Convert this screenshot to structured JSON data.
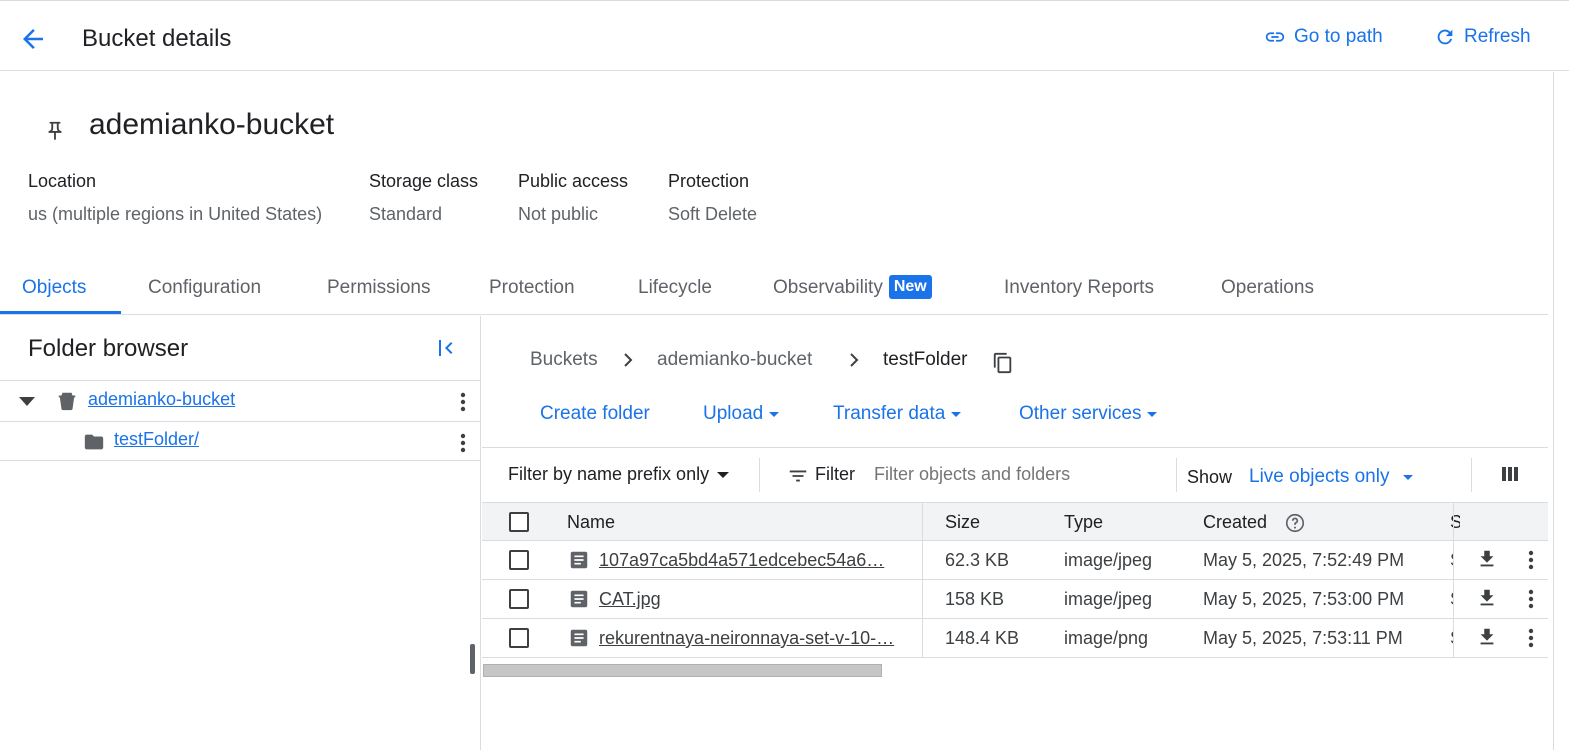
{
  "header": {
    "title": "Bucket details",
    "goto_path": "Go to path",
    "refresh": "Refresh"
  },
  "bucket": {
    "name": "ademianko-bucket",
    "info": [
      {
        "label": "Location",
        "value": "us (multiple regions in United States)"
      },
      {
        "label": "Storage class",
        "value": "Standard"
      },
      {
        "label": "Public access",
        "value": "Not public"
      },
      {
        "label": "Protection",
        "value": "Soft Delete"
      }
    ]
  },
  "tabs": [
    {
      "label": "Objects",
      "active": true
    },
    {
      "label": "Configuration"
    },
    {
      "label": "Permissions"
    },
    {
      "label": "Protection"
    },
    {
      "label": "Lifecycle"
    },
    {
      "label": "Observability",
      "badge": "New"
    },
    {
      "label": "Inventory Reports"
    },
    {
      "label": "Operations"
    }
  ],
  "folder_browser": {
    "title": "Folder browser",
    "items": [
      {
        "label": "ademianko-bucket",
        "type": "bucket"
      },
      {
        "label": "testFolder/",
        "type": "folder"
      }
    ]
  },
  "breadcrumb": {
    "items": [
      "Buckets",
      "ademianko-bucket",
      "testFolder"
    ]
  },
  "actions": {
    "create_folder": "Create folder",
    "upload": "Upload",
    "transfer_data": "Transfer data",
    "other_services": "Other services"
  },
  "filter": {
    "mode": "Filter by name prefix only",
    "label": "Filter",
    "placeholder": "Filter objects and folders",
    "show_label": "Show",
    "show_value": "Live objects only"
  },
  "table": {
    "columns": [
      "Name",
      "Size",
      "Type",
      "Created",
      "S"
    ],
    "rows": [
      {
        "name": "107a97ca5bd4a571edcebec54a6…",
        "size": "62.3 KB",
        "type": "image/jpeg",
        "created": "May 5, 2025, 7:52:49 PM",
        "cut": "S"
      },
      {
        "name": "CAT.jpg",
        "size": "158 KB",
        "type": "image/jpeg",
        "created": "May 5, 2025, 7:53:00 PM",
        "cut": "S"
      },
      {
        "name": "rekurentnaya-neironnaya-set-v-10-…",
        "size": "148.4 KB",
        "type": "image/png",
        "created": "May 5, 2025, 7:53:11 PM",
        "cut": "S"
      }
    ]
  },
  "colors": {
    "accent": "#1a73e8",
    "border": "#dadce0",
    "header_bg": "#f1f3f4",
    "text": "#202124",
    "muted": "#5f6368"
  }
}
